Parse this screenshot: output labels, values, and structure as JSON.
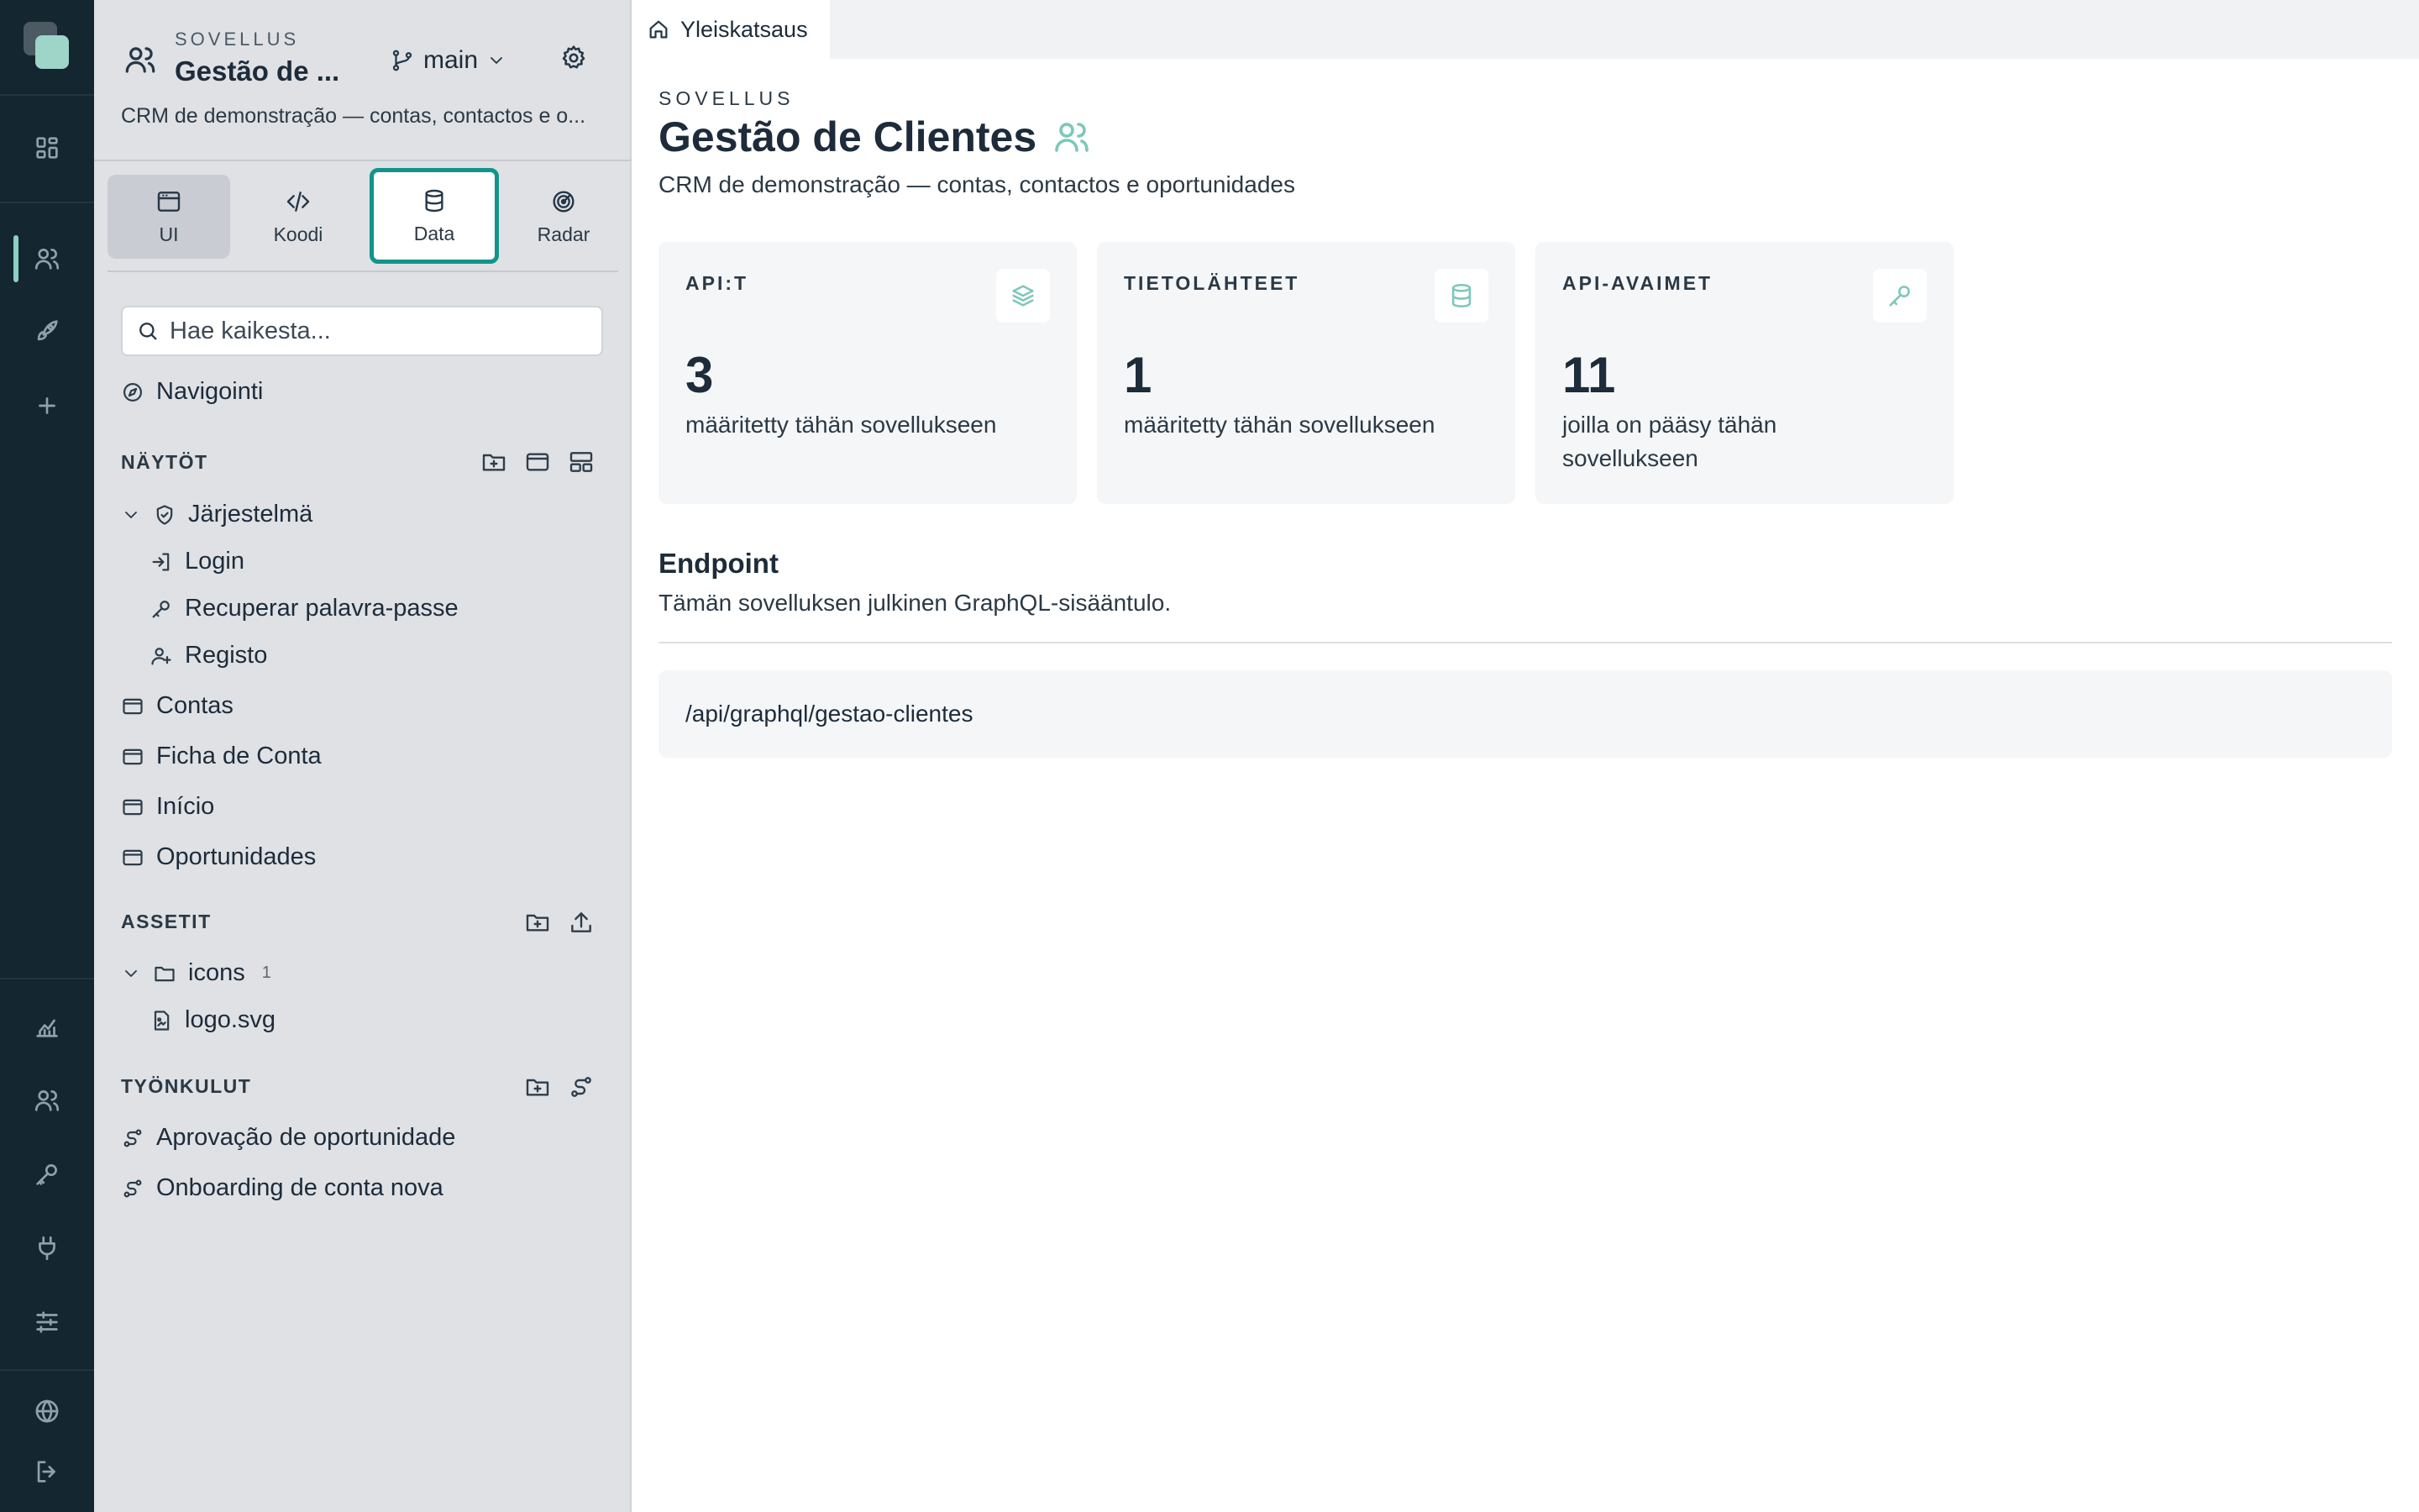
{
  "app": {
    "eyebrow": "SOVELLUS",
    "name_short": "Gestão de ...",
    "branch": "main",
    "description": "CRM de demonstração — contas, contactos e o..."
  },
  "tabs": [
    {
      "label": "UI",
      "icon": "window-icon"
    },
    {
      "label": "Koodi",
      "icon": "code-icon"
    },
    {
      "label": "Data",
      "icon": "database-icon",
      "selected": true
    },
    {
      "label": "Radar",
      "icon": "radar-icon"
    }
  ],
  "search": {
    "placeholder": "Hae kaikesta..."
  },
  "nav": {
    "label": "Navigointi"
  },
  "screens": {
    "title": "NÄYTÖT",
    "group": "Järjestelmä",
    "group_items": [
      "Login",
      "Recuperar palavra-passe",
      "Registo"
    ],
    "items": [
      "Contas",
      "Ficha de Conta",
      "Início",
      "Oportunidades"
    ]
  },
  "assets": {
    "title": "ASSETIT",
    "folder": "icons",
    "folder_count": "1",
    "file": "logo.svg"
  },
  "workflows": {
    "title": "TYÖNKULUT",
    "items": [
      "Aprovação de oportunidade",
      "Onboarding de conta nova"
    ]
  },
  "main": {
    "tab": "Yleiskatsaus",
    "eyebrow": "SOVELLUS",
    "title": "Gestão de Clientes",
    "description": "CRM de demonstração — contas, contactos e oportunidades",
    "cards": [
      {
        "label": "API:T",
        "value": "3",
        "sub": "määritetty tähän sovellukseen",
        "icon": "layers-icon"
      },
      {
        "label": "TIETOLÄHTEET",
        "value": "1",
        "sub": "määritetty tähän sovellukseen",
        "icon": "database-icon"
      },
      {
        "label": "API-AVAIMET",
        "value": "11",
        "sub": "joilla on pääsy tähän sovellukseen",
        "icon": "key-icon"
      }
    ],
    "endpoint": {
      "title": "Endpoint",
      "description": "Tämän sovelluksen julkinen GraphQL-sisääntulo.",
      "url": "/api/graphql/gestao-clientes"
    }
  },
  "colors": {
    "rail": "#14262f",
    "sidebar": "#dfe1e5",
    "accent": "#12948a",
    "icon_accent": "#7cc8b9"
  }
}
